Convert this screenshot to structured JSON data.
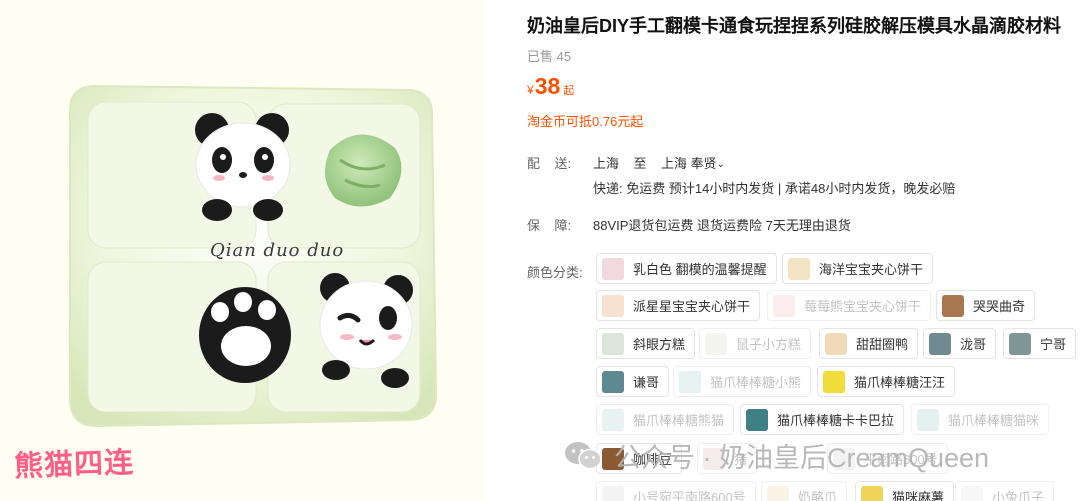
{
  "product": {
    "title": "奶油皇后DIY手工翻模卡通食玩捏捏系列硅胶解压模具水晶滴胶材料",
    "sold": "已售 45",
    "price_currency": "¥",
    "price_value": "38",
    "price_suffix": "起",
    "coin_text": "淘金币可抵0.76元起"
  },
  "image": {
    "script_text": "Qian duo duo",
    "corner_text": "熊猫四连"
  },
  "shipping": {
    "label": "配    送:",
    "from": "上海",
    "to_word": "至",
    "to": "上海 奉贤",
    "chevron": "⌄",
    "detail": "快递: 免运费  预计14小时内发货 | 承诺48小时内发货，晚发必赔"
  },
  "guarantee": {
    "label": "保    障:",
    "text": "88VIP退货包运费 退货运费险 7天无理由退货"
  },
  "color": {
    "label": "颜色分类:",
    "options": [
      {
        "label": "乳白色 翻模的温馨提醒",
        "thumb": "#f1d9df"
      },
      {
        "label": "海洋宝宝夹心饼干",
        "thumb": "#f4e3c3"
      },
      {
        "label": "派星星宝宝夹心饼干",
        "thumb": "#f6e2cf"
      },
      {
        "label": "莓莓熊宝宝夹心饼干",
        "thumb": "#f7d5d8"
      },
      {
        "label": "哭哭曲奇",
        "thumb": "#a9774f"
      },
      {
        "label": "斜眼方糕",
        "thumb": "#d9e6d9"
      },
      {
        "label": "鼠子小方糕",
        "thumb": "#e8e8de"
      },
      {
        "label": "甜甜圈鸭",
        "thumb": "#f2d9b8"
      },
      {
        "label": "泷哥",
        "thumb": "#6f8b91"
      },
      {
        "label": "宁哥",
        "thumb": "#7f959a"
      },
      {
        "label": "谦哥",
        "thumb": "#5d8a8f"
      },
      {
        "label": "猫爪棒棒糖小熊",
        "thumb": "#c8dfe0"
      },
      {
        "label": "猫爪棒棒糖汪汪",
        "thumb": "#f2dc3a"
      },
      {
        "label": "猫爪棒棒糖熊猫",
        "thumb": "#c9e2e0"
      },
      {
        "label": "猫爪棒棒糖卡卡巴拉",
        "thumb": "#3f7f86"
      },
      {
        "label": "猫爪棒棒糖猫咪",
        "thumb": "#c6dfe0"
      },
      {
        "label": "咖啡豆",
        "thumb": "#8b5a35"
      },
      {
        "label": "猪",
        "thumb": "#e7d3d6"
      },
      {
        "label": "平南路600号",
        "thumb": "#e5e5e5"
      },
      {
        "label": "小号宛平南路600号",
        "thumb": "#e6e6e6"
      },
      {
        "label": "奶酪爪",
        "thumb": "#f1e6c8"
      },
      {
        "label": "猫咪麻薯",
        "thumb": "#f0d45a"
      },
      {
        "label": "小兔爪子",
        "thumb": "#eee"
      }
    ]
  },
  "watermark": {
    "text": "公众号 · 奶油皇后CreamQueen",
    "icon": "wechat-icon"
  },
  "colors": {
    "accent": "#ff5000",
    "corner_text": "#ff5f86"
  }
}
